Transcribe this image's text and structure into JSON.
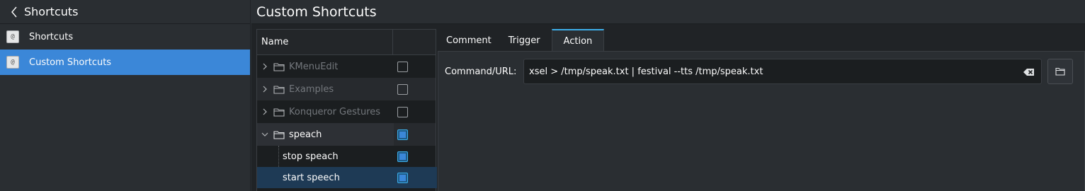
{
  "sidebar": {
    "title": "Shortcuts",
    "items": [
      {
        "label": "Shortcuts",
        "icon": "shortcuts-icon"
      },
      {
        "label": "Custom Shortcuts",
        "icon": "custom-shortcuts-icon",
        "selected": true
      }
    ]
  },
  "main": {
    "title": "Custom Shortcuts"
  },
  "tree": {
    "column_name": "Name",
    "rows": [
      {
        "label": "KMenuEdit",
        "checked": false,
        "disabled": true
      },
      {
        "label": "Examples",
        "checked": false,
        "disabled": true
      },
      {
        "label": "Konqueror Gestures",
        "checked": false,
        "disabled": true
      },
      {
        "label": "speach",
        "checked": true,
        "expanded": true
      },
      {
        "label": "stop speach",
        "checked": true
      },
      {
        "label": "start speech",
        "checked": true,
        "selected": true
      }
    ]
  },
  "tabs": [
    {
      "label": "Comment"
    },
    {
      "label": "Trigger"
    },
    {
      "label": "Action",
      "active": true
    }
  ],
  "action": {
    "command_label": "Command/URL:",
    "command_value": "xsel > /tmp/speak.txt | festival --tts /tmp/speak.txt"
  },
  "colors": {
    "accent": "#3b87d8",
    "background": "#2a2e32",
    "view_background": "#1b1e20"
  }
}
